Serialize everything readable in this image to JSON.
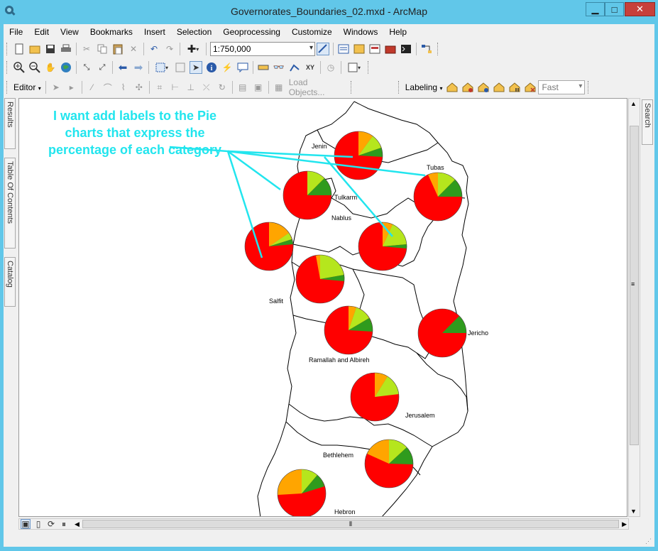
{
  "window": {
    "title": "Governorates_Boundaries_02.mxd - ArcMap",
    "minimize": "▁",
    "maximize": "□",
    "close": "✕"
  },
  "menu": [
    "File",
    "Edit",
    "View",
    "Bookmarks",
    "Insert",
    "Selection",
    "Geoprocessing",
    "Customize",
    "Windows",
    "Help"
  ],
  "toolbar": {
    "scale_value": "1:750,000",
    "editor_label": "Editor",
    "load_objects_label": "Load Objects...",
    "labeling_label": "Labeling",
    "label_quality": "Fast"
  },
  "side_tabs": {
    "results": "Results",
    "toc": "Table Of Contents",
    "catalog": "Catalog",
    "search": "Search"
  },
  "annotation": {
    "text": "I want add labels to the Pie charts that express the percentage of each category",
    "color": "#22e5ee"
  },
  "map": {
    "places": [
      "Jenin",
      "Tubas",
      "Tulkarm",
      "Nablus",
      "Salfit",
      "Jericho",
      "Ramallah and Albireh",
      "Jerusalem",
      "Bethlehem",
      "Hebron"
    ],
    "pie_colors": {
      "red": "#ff0000",
      "orange": "#ffa500",
      "lime": "#b5e61d",
      "green": "#2f9b1d"
    }
  }
}
